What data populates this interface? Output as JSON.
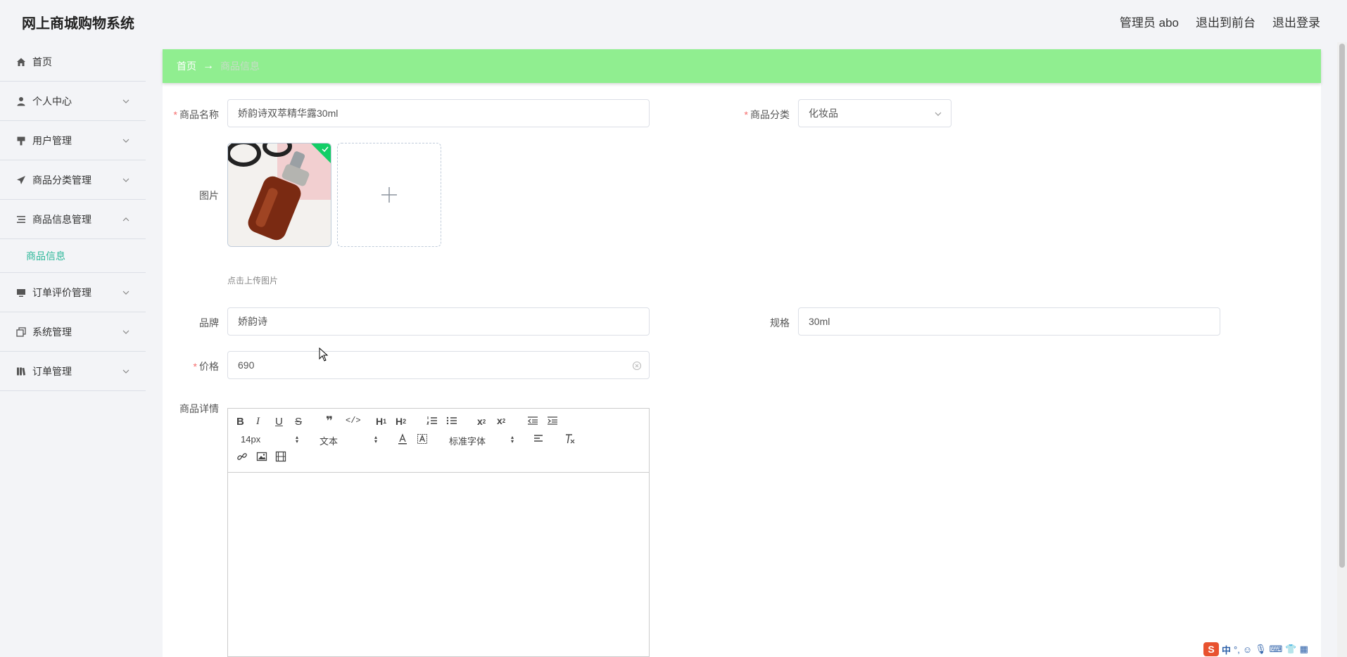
{
  "header": {
    "title": "网上商城购物系统",
    "admin": "管理员 abo",
    "to_front": "退出到前台",
    "logout": "退出登录"
  },
  "sidebar": {
    "items": [
      {
        "label": "首页",
        "icon": "home-icon"
      },
      {
        "label": "个人中心",
        "icon": "user-icon"
      },
      {
        "label": "用户管理",
        "icon": "brush-icon"
      },
      {
        "label": "商品分类管理",
        "icon": "send-icon"
      },
      {
        "label": "商品信息管理",
        "icon": "list-icon"
      },
      {
        "label": "订单评价管理",
        "icon": "monitor-icon"
      },
      {
        "label": "系统管理",
        "icon": "copy-icon"
      },
      {
        "label": "订单管理",
        "icon": "books-icon"
      }
    ],
    "sub_active": "商品信息"
  },
  "breadcrumb": {
    "home": "首页",
    "sep": "→",
    "current": "商品信息"
  },
  "form": {
    "name_label": "商品名称",
    "name_value": "娇韵诗双萃精华露30ml",
    "category_label": "商品分类",
    "category_value": "化妆品",
    "image_label": "图片",
    "upload_tip": "点击上传图片",
    "brand_label": "品牌",
    "brand_value": "娇韵诗",
    "spec_label": "规格",
    "spec_value": "30ml",
    "price_label": "价格",
    "price_value": "690",
    "detail_label": "商品详情",
    "required_mark": "*"
  },
  "editor": {
    "font_size": "14px",
    "heading": "文本",
    "font_family": "标准字体"
  },
  "ime": {
    "lang": "中"
  },
  "colors": {
    "breadcrumb_bg": "#90ee90",
    "active_submenu": "#2eb89a",
    "required": "#f56c6c",
    "check_badge": "#13ce66"
  }
}
